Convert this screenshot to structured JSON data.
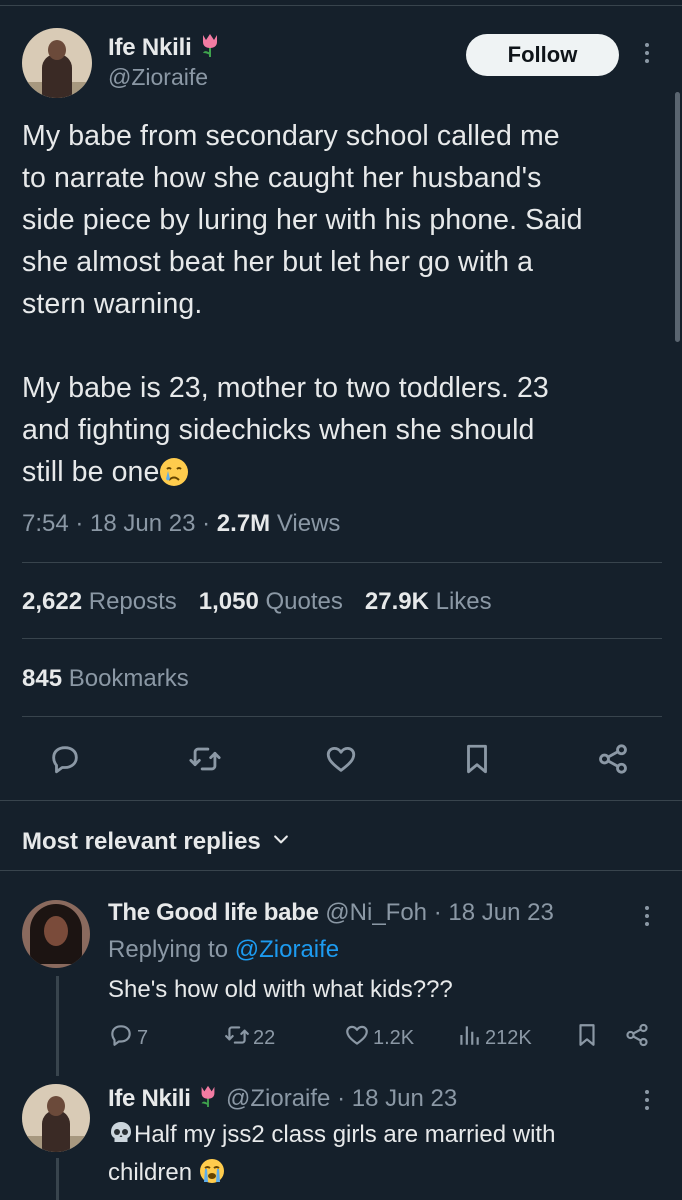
{
  "tweet": {
    "author_name": "Ife Nkili",
    "author_handle": "@Zioraife",
    "follow_label": "Follow",
    "text": "My babe from secondary school called me\nto narrate how she caught her husband's\nside piece by luring her with his phone. Said\nshe almost beat her but let her go with a\nstern warning.\n\nMy babe is 23, mother to two toddlers. 23\nand fighting sidechicks when she should\nstill be one",
    "emoji": "crying-face",
    "time": "7:54",
    "date": "18 Jun 23",
    "views_count": "2.7M",
    "views_label": "Views",
    "reposts_count": "2,622",
    "reposts_label": "Reposts",
    "quotes_count": "1,050",
    "quotes_label": "Quotes",
    "likes_count": "27.9K",
    "likes_label": "Likes",
    "bookmarks_count": "845",
    "bookmarks_label": "Bookmarks"
  },
  "replies_header": "Most relevant replies",
  "replies": [
    {
      "name": "The Good life babe",
      "handle": "@Ni_Foh",
      "date": "18 Jun 23",
      "replying_prefix": "Replying to",
      "replying_to": "@Zioraife",
      "text": "She's how old with what kids???",
      "reply_count": "7",
      "repost_count": "22",
      "like_count": "1.2K",
      "view_count": "212K"
    },
    {
      "name": "Ife Nkili",
      "handle": "@Zioraife",
      "date": "18 Jun 23",
      "text_line1": "Half my jss2 class girls are married with",
      "text_line2": "children",
      "lead_emoji": "skull",
      "trail_emoji": "loudly-crying-face"
    }
  ],
  "colors": {
    "background": "#15202b",
    "text": "#e7e9ea",
    "secondary_text": "#8b98a5",
    "link": "#1d9bf0",
    "divider": "#38444d"
  }
}
